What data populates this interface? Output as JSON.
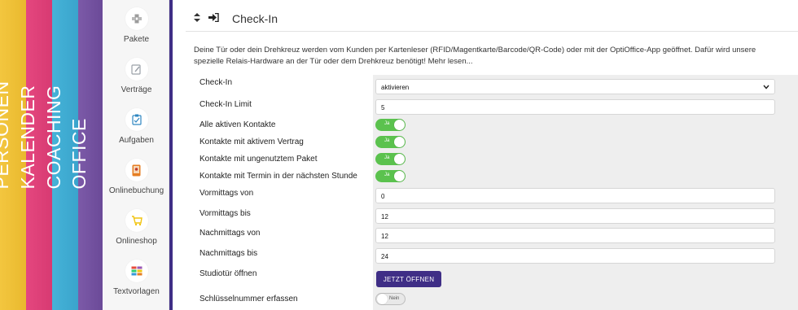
{
  "side_tabs": [
    {
      "label": "PERSONEN",
      "color": "#f3c63f"
    },
    {
      "label": "KALENDER",
      "color": "#e5477f"
    },
    {
      "label": "COACHING",
      "color": "#45b3d8"
    },
    {
      "label": "OFFICE",
      "color": "#7c5aa8"
    }
  ],
  "sidebar": {
    "items": [
      {
        "label": "Pakete",
        "icon": "boxes-icon"
      },
      {
        "label": "Verträge",
        "icon": "edit-document-icon"
      },
      {
        "label": "Aufgaben",
        "icon": "clipboard-icon"
      },
      {
        "label": "Onlinebuchung",
        "icon": "mobile-booking-icon"
      },
      {
        "label": "Onlineshop",
        "icon": "shopping-cart-icon"
      },
      {
        "label": "Textvorlagen",
        "icon": "templates-icon"
      }
    ]
  },
  "header": {
    "title": "Check-In",
    "icons": [
      "sort-icon",
      "sign-in-icon"
    ]
  },
  "description": "Deine Tür oder dein Drehkreuz werden vom Kunden per Kartenleser (RFID/Magentkarte/Barcode/QR-Code) oder mit der OptiOffice-App geöffnet. Dafür wird unsere spezielle Relais-Hardware an der Tür oder dem Drehkreuz benötigt! Mehr lesen...",
  "form": {
    "checkin": {
      "label": "Check-In",
      "value": "aktivieren"
    },
    "checkin_limit": {
      "label": "Check-In Limit",
      "value": "5"
    },
    "alle_kontakte": {
      "label": "Alle aktiven Kontakte",
      "toggle": "Ja"
    },
    "kontakte_vertrag": {
      "label": "Kontakte mit aktivem Vertrag",
      "toggle": "Ja"
    },
    "kontakte_paket": {
      "label": "Kontakte mit ungenutztem Paket",
      "toggle": "Ja"
    },
    "kontakte_termin": {
      "label": "Kontakte mit Termin in der nächsten Stunde",
      "toggle": "Ja"
    },
    "vormittags_von": {
      "label": "Vormittags von",
      "value": "0"
    },
    "vormittags_bis": {
      "label": "Vormittags bis",
      "value": "12"
    },
    "nachmittags_von": {
      "label": "Nachmittags von",
      "value": "12"
    },
    "nachmittags_bis": {
      "label": "Nachmittags bis",
      "value": "24"
    },
    "studiotuer": {
      "label": "Studiotür öffnen",
      "button": "JETZT ÖFFNEN"
    },
    "schluessel": {
      "label": "Schlüsselnummer erfassen",
      "toggle": "Nein"
    }
  },
  "colors": {
    "accent": "#3f2e86",
    "toggle_on": "#5bc24e"
  }
}
